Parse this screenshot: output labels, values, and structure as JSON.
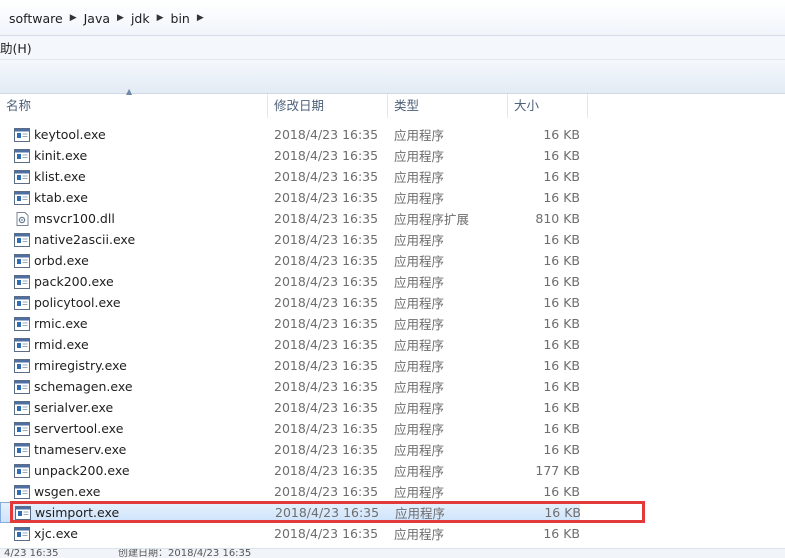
{
  "breadcrumb": [
    "software",
    "Java",
    "jdk",
    "bin"
  ],
  "menu": {
    "help_label": "助(H)"
  },
  "columns": {
    "name": "名称",
    "date": "修改日期",
    "type": "类型",
    "size": "大小"
  },
  "files": [
    {
      "name": "keytool.exe",
      "date": "2018/4/23 16:35",
      "type": "应用程序",
      "size": "16 KB",
      "icon": "exe-icon"
    },
    {
      "name": "kinit.exe",
      "date": "2018/4/23 16:35",
      "type": "应用程序",
      "size": "16 KB",
      "icon": "exe-icon"
    },
    {
      "name": "klist.exe",
      "date": "2018/4/23 16:35",
      "type": "应用程序",
      "size": "16 KB",
      "icon": "exe-icon"
    },
    {
      "name": "ktab.exe",
      "date": "2018/4/23 16:35",
      "type": "应用程序",
      "size": "16 KB",
      "icon": "exe-icon"
    },
    {
      "name": "msvcr100.dll",
      "date": "2018/4/23 16:35",
      "type": "应用程序扩展",
      "size": "810 KB",
      "icon": "dll-icon"
    },
    {
      "name": "native2ascii.exe",
      "date": "2018/4/23 16:35",
      "type": "应用程序",
      "size": "16 KB",
      "icon": "exe-icon"
    },
    {
      "name": "orbd.exe",
      "date": "2018/4/23 16:35",
      "type": "应用程序",
      "size": "16 KB",
      "icon": "exe-icon"
    },
    {
      "name": "pack200.exe",
      "date": "2018/4/23 16:35",
      "type": "应用程序",
      "size": "16 KB",
      "icon": "exe-icon"
    },
    {
      "name": "policytool.exe",
      "date": "2018/4/23 16:35",
      "type": "应用程序",
      "size": "16 KB",
      "icon": "exe-icon"
    },
    {
      "name": "rmic.exe",
      "date": "2018/4/23 16:35",
      "type": "应用程序",
      "size": "16 KB",
      "icon": "exe-icon"
    },
    {
      "name": "rmid.exe",
      "date": "2018/4/23 16:35",
      "type": "应用程序",
      "size": "16 KB",
      "icon": "exe-icon"
    },
    {
      "name": "rmiregistry.exe",
      "date": "2018/4/23 16:35",
      "type": "应用程序",
      "size": "16 KB",
      "icon": "exe-icon"
    },
    {
      "name": "schemagen.exe",
      "date": "2018/4/23 16:35",
      "type": "应用程序",
      "size": "16 KB",
      "icon": "exe-icon"
    },
    {
      "name": "serialver.exe",
      "date": "2018/4/23 16:35",
      "type": "应用程序",
      "size": "16 KB",
      "icon": "exe-icon"
    },
    {
      "name": "servertool.exe",
      "date": "2018/4/23 16:35",
      "type": "应用程序",
      "size": "16 KB",
      "icon": "exe-icon"
    },
    {
      "name": "tnameserv.exe",
      "date": "2018/4/23 16:35",
      "type": "应用程序",
      "size": "16 KB",
      "icon": "exe-icon"
    },
    {
      "name": "unpack200.exe",
      "date": "2018/4/23 16:35",
      "type": "应用程序",
      "size": "177 KB",
      "icon": "exe-icon"
    },
    {
      "name": "wsgen.exe",
      "date": "2018/4/23 16:35",
      "type": "应用程序",
      "size": "16 KB",
      "icon": "exe-icon"
    },
    {
      "name": "wsimport.exe",
      "date": "2018/4/23 16:35",
      "type": "应用程序",
      "size": "16 KB",
      "icon": "exe-icon",
      "selected": true
    },
    {
      "name": "xjc.exe",
      "date": "2018/4/23 16:35",
      "type": "应用程序",
      "size": "16 KB",
      "icon": "exe-icon"
    }
  ],
  "status": {
    "modified": "4/23 16:35",
    "created": "创建日期：2018/4/23 16:35"
  },
  "colors": {
    "highlight": "#e23a3a",
    "selection": "#cde3fb",
    "header_text": "#4c607a"
  }
}
